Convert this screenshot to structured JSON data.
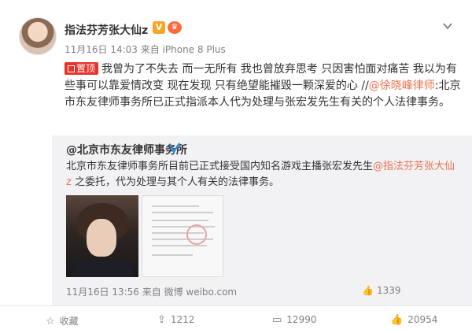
{
  "post": {
    "author": "指法芬芳张大仙z",
    "verified_badge": "V",
    "level_badge": "♛",
    "timestamp": "11月16日 14:03",
    "source": "来自 iPhone 8 Plus",
    "pin_label": "置顶",
    "text_main": "我曾为了不失去 而一无所有 我也曾放弃思考 只因害怕面对痛苦 我以为有些事可以靠爱情改变 现在发现 只有绝望能摧毁一颗深爱的心 ",
    "text_sep": "//",
    "mention": "@徐晓峰律师",
    "text_after": ":北京市东友律师事务所已正式指派本人代为处理与张宏发先生有关的个人法律事务。"
  },
  "repost": {
    "author": "@北京市东友律师事务所",
    "text_before": "北京市东友律师事务所目前已正式接受国内知名游戏主播张宏发先生",
    "mention": "@指法芬芳张大仙z",
    "text_after": " 之委托，代为处理与其个人有关的法律事务。",
    "timestamp": "11月16日 13:56",
    "source": "来自 微博 weibo.com",
    "like_count": "1339"
  },
  "actions": {
    "favorite_label": "收藏",
    "share_count": "1212",
    "comment_count": "12990",
    "like_count": "20954"
  },
  "icons": {
    "more": "chevron-down-icon",
    "favorite": "star-icon",
    "share": "share-icon",
    "comment": "comment-icon",
    "like": "thumbs-up-icon"
  },
  "colors": {
    "mention": "#eb7350",
    "pin": "#e8332a",
    "repost_bg": "#f2f2f5"
  }
}
